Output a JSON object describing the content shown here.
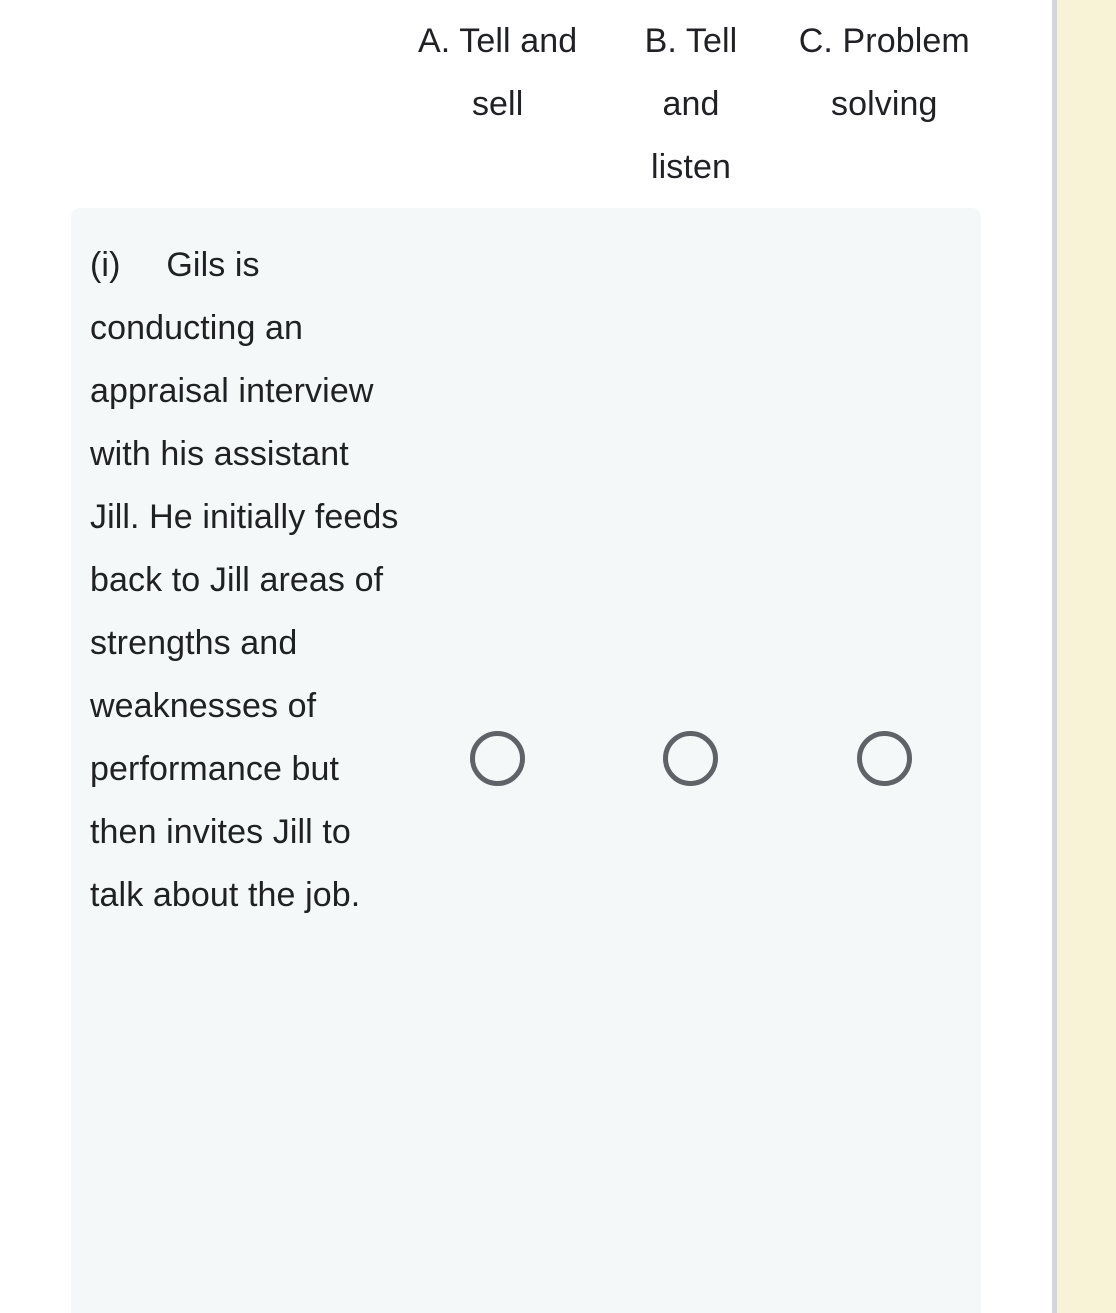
{
  "theme": {
    "page_background": "#ffffff",
    "row_background": "#f4f8f9",
    "text_color": "#202124",
    "radio_color": "#5f6368",
    "edge_band_color": "#f8f3d6",
    "edge_divider_color": "#d5d6da"
  },
  "grid": {
    "columns": [
      {
        "id": "a",
        "label": "A. Tell and sell"
      },
      {
        "id": "b",
        "label": "B. Tell and listen"
      },
      {
        "id": "c",
        "label": "C. Problem solving"
      }
    ],
    "rows": [
      {
        "id": "i",
        "label": "(i)\tGils is conducting an appraisal interview with his assistant Jill. He initially feeds back to Jill areas of strengths and weaknesses of performance but then invites Jill to talk about the job.",
        "selected": null,
        "options": [
          {
            "column_id": "a",
            "selected": false
          },
          {
            "column_id": "b",
            "selected": false
          },
          {
            "column_id": "c",
            "selected": false
          }
        ]
      }
    ]
  }
}
